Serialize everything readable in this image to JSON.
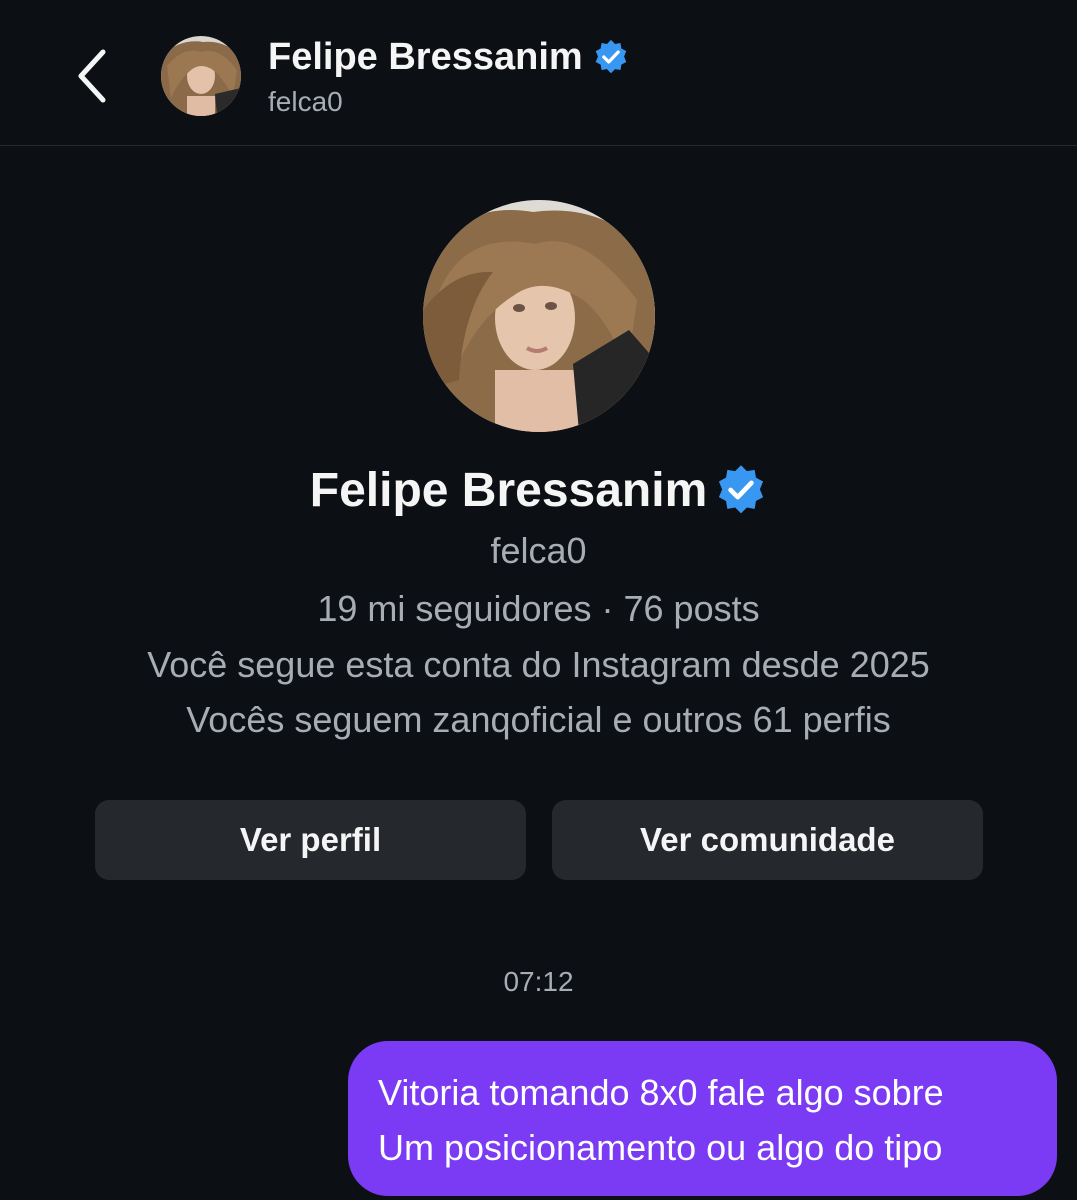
{
  "header": {
    "back_icon": "chevron-left-icon",
    "name": "Felipe Bressanim",
    "username": "felca0",
    "verified_icon": "verified-badge-icon"
  },
  "profile": {
    "name": "Felipe Bressanim",
    "username": "felca0",
    "stats": "19 mi seguidores · 76 posts",
    "follow_since": "Você segue esta conta do Instagram desde 2025",
    "mutuals": "Vocês seguem zanqoficial e outros 61 perfis",
    "verified_icon": "verified-badge-icon"
  },
  "buttons": {
    "view_profile": "Ver perfil",
    "view_community": "Ver comunidade"
  },
  "chat": {
    "timestamp": "07:12",
    "message_lines": [
      "Vitoria tomando 8x0 fale algo sobre",
      "Um posicionamento ou algo do tipo"
    ]
  },
  "colors": {
    "background": "#0c1014",
    "button": "#25292e",
    "bubble": "#7b3af3",
    "verified": "#3897f0",
    "muted_text": "#a8adb3"
  }
}
